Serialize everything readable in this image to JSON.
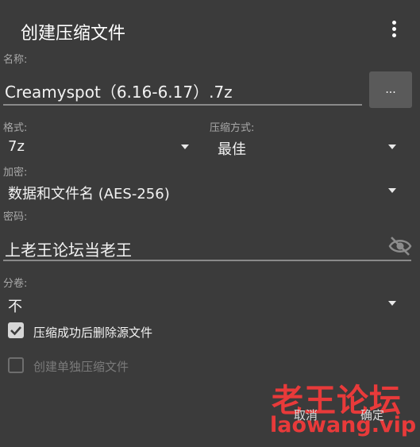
{
  "dialog": {
    "title": "创建压缩文件",
    "name_label": "名称:",
    "name_value": "Creamyspot（6.16-6.17）.7z",
    "browse_label": "...",
    "format_label": "格式:",
    "format_value": "7z",
    "method_label": "压缩方式:",
    "method_value": "最佳",
    "encrypt_label": "加密:",
    "encrypt_value": "数据和文件名 (AES-256)",
    "password_label": "密码:",
    "password_value": "上老王论坛当老王",
    "volume_label": "分卷:",
    "volume_value": "不",
    "delete_source": {
      "label": "压缩成功后删除源文件",
      "checked": true
    },
    "separate_archives": {
      "label": "创建单独压缩文件",
      "checked": false,
      "enabled": false
    },
    "cancel_label": "取消",
    "ok_label": "确定"
  },
  "watermark": {
    "line1": "老王论坛",
    "line2": "laowang.vip"
  },
  "icons": {
    "menu": "more-vert-icon",
    "visibility": "eye-off-icon",
    "dropdown": "caret-down-icon"
  },
  "colors": {
    "background": "#3b3b3b",
    "watermark": "#e83a3a"
  }
}
